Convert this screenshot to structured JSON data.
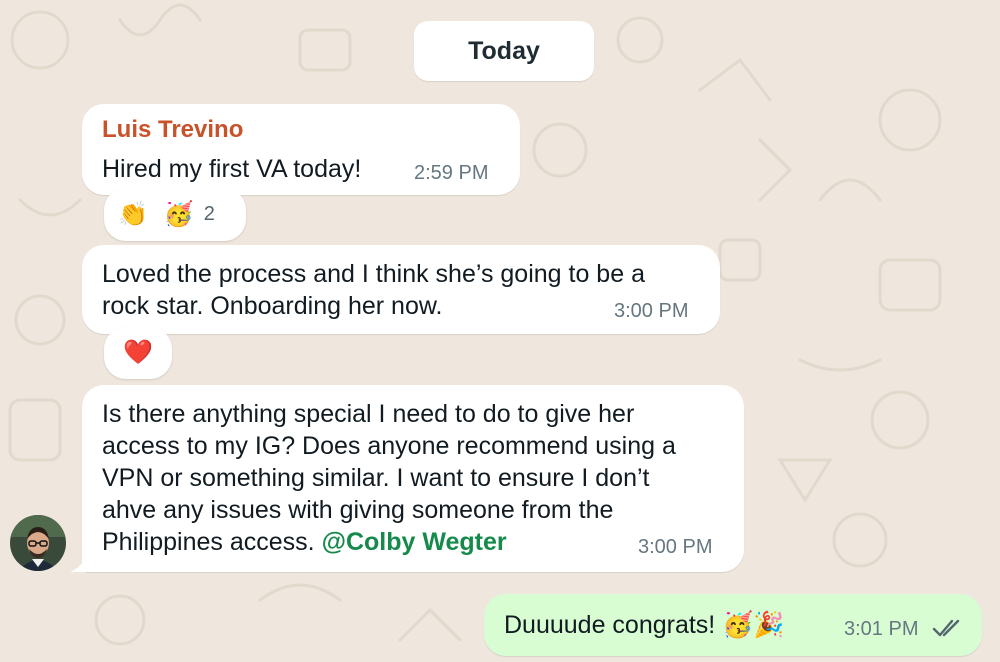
{
  "date_separator": "Today",
  "messages": [
    {
      "sender": "Luis Trevino",
      "text": "Hired my first VA today!",
      "time": "2:59 PM",
      "reactions": {
        "emojis": [
          "👏",
          "🥳"
        ],
        "count": "2"
      }
    },
    {
      "line1": "Loved the process and I think she’s going to be a",
      "line2": "rock star. Onboarding her now.",
      "time": "3:00 PM",
      "reactions": {
        "emojis": [
          "❤️"
        ]
      }
    },
    {
      "line1": "Is there anything special I need to do to give her",
      "line2": "access to my IG? Does anyone recommend using a",
      "line3": "VPN or something similar. I want to ensure I don’t",
      "line4": "ahve any issues with giving someone from the",
      "line5_text": "Philippines access. ",
      "mention": "@Colby Wegter",
      "time": "3:00 PM"
    }
  ],
  "outgoing": {
    "text": "Duuuude congrats! 🥳🎉",
    "time": "3:01 PM",
    "status": "read"
  },
  "icons": {
    "avatar": "profile-photo",
    "read_receipt": "double-check-icon"
  },
  "colors": {
    "background": "#efe7de",
    "sender_name": "#c8522a",
    "mention": "#168a4b",
    "outgoing_bubble": "#d9fdd3",
    "read_ticks": "#54656f"
  }
}
